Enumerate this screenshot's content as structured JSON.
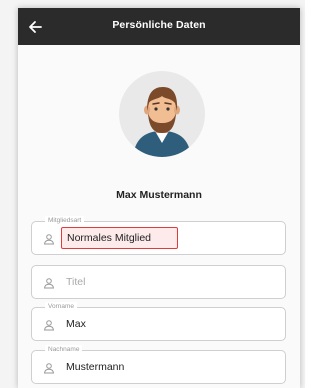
{
  "appbar": {
    "title": "Persönliche Daten"
  },
  "profile": {
    "name": "Max Mustermann"
  },
  "fields": {
    "membership": {
      "label": "Mitgliedsart",
      "value": "Normales Mitglied"
    },
    "title": {
      "placeholder": "Titel"
    },
    "firstname": {
      "label": "Vorname",
      "value": "Max"
    },
    "lastname": {
      "label": "Nachname",
      "value": "Mustermann"
    }
  },
  "colors": {
    "appbar": "#2b2b2b",
    "highlight_border": "#e03b3b",
    "avatar_shirt": "#2f5d7c"
  }
}
